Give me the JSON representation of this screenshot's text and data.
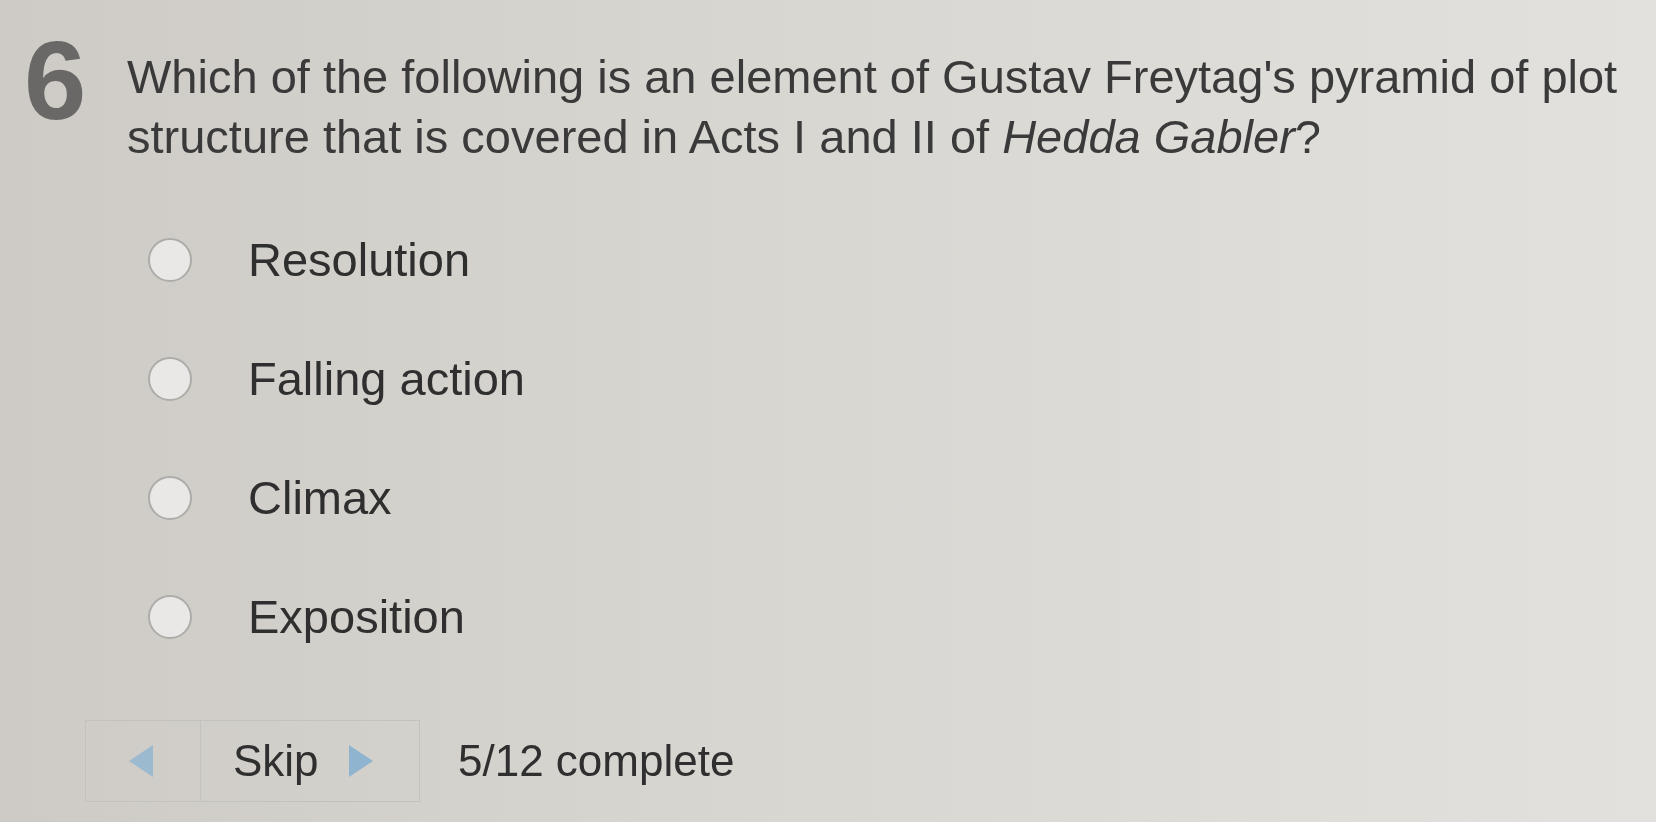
{
  "question": {
    "number": "6",
    "text": "Which of the following is an element of Gustav Freytag's pyramid of plot structure that is covered in Acts I and II of *Hedda Gabler*?"
  },
  "options": [
    {
      "label": "Resolution",
      "selected": false
    },
    {
      "label": "Falling action",
      "selected": false
    },
    {
      "label": "Climax",
      "selected": false
    },
    {
      "label": "Exposition",
      "selected": false
    }
  ],
  "navigation": {
    "skip_label": "Skip",
    "progress": "5/12 complete"
  }
}
